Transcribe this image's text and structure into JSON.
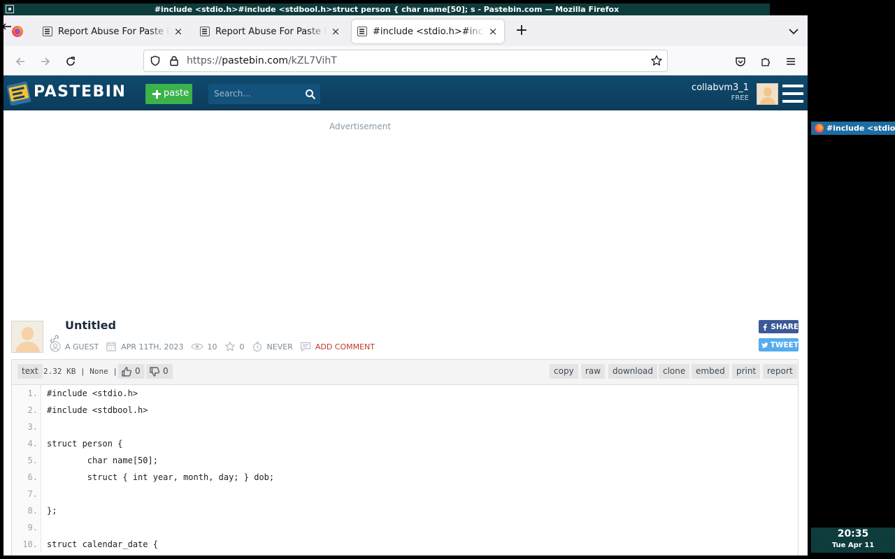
{
  "window": {
    "title": "#include <stdio.h>#include <stdbool.h>struct person { char name[50]; s - Pastebin.com — Mozilla Firefox"
  },
  "tabs": [
    {
      "label": "Report Abuse For Paste ID: ",
      "active": false
    },
    {
      "label": "Report Abuse For Paste ID: ",
      "active": false
    },
    {
      "label": "#include <stdio.h>#include <",
      "active": true
    }
  ],
  "urlbar": {
    "prefix": "https://",
    "domain": "pastebin.com",
    "path": "/kZL7VihT"
  },
  "site": {
    "logo_text": "PASTEBIN",
    "paste_button": "paste",
    "search_placeholder": "Search...",
    "username": "collabvm3_1",
    "plan": "FREE",
    "ad_label": "Advertisement"
  },
  "paste": {
    "title": "Untitled",
    "author": "A GUEST",
    "date": "APR 11TH, 2023",
    "views": "10",
    "stars": "0",
    "expires": "NEVER",
    "add_comment": "ADD COMMENT",
    "share_label": "SHARE",
    "tweet_label": "TWEET",
    "syntax": "text",
    "info": "2.32 KB | None |",
    "likes": "0",
    "dislikes": "0",
    "actions": [
      "copy",
      "raw",
      "download",
      "clone",
      "embed",
      "print",
      "report"
    ]
  },
  "code_lines": [
    {
      "n": "1.",
      "text": "#include <stdio.h>"
    },
    {
      "n": "2.",
      "text": "#include <stdbool.h>"
    },
    {
      "n": "3.",
      "text": ""
    },
    {
      "n": "4.",
      "text": "struct person {"
    },
    {
      "n": "5.",
      "text": "        char name[50];"
    },
    {
      "n": "6.",
      "text": "        struct { int year, month, day; } dob;"
    },
    {
      "n": "7.",
      "text": ""
    },
    {
      "n": "8.",
      "text": "};"
    },
    {
      "n": "9.",
      "text": ""
    },
    {
      "n": "10.",
      "text": "struct calendar_date {"
    }
  ],
  "taskbar": {
    "item": "#include <stdio.h>",
    "time": "20:35",
    "date": "Tue Apr 11"
  },
  "colors": {
    "pastebin_header": "#0f4a6e",
    "paste_button": "#3cb24b",
    "wm_bar": "#0e3b3c",
    "taskbar_item": "#1f6da0"
  }
}
